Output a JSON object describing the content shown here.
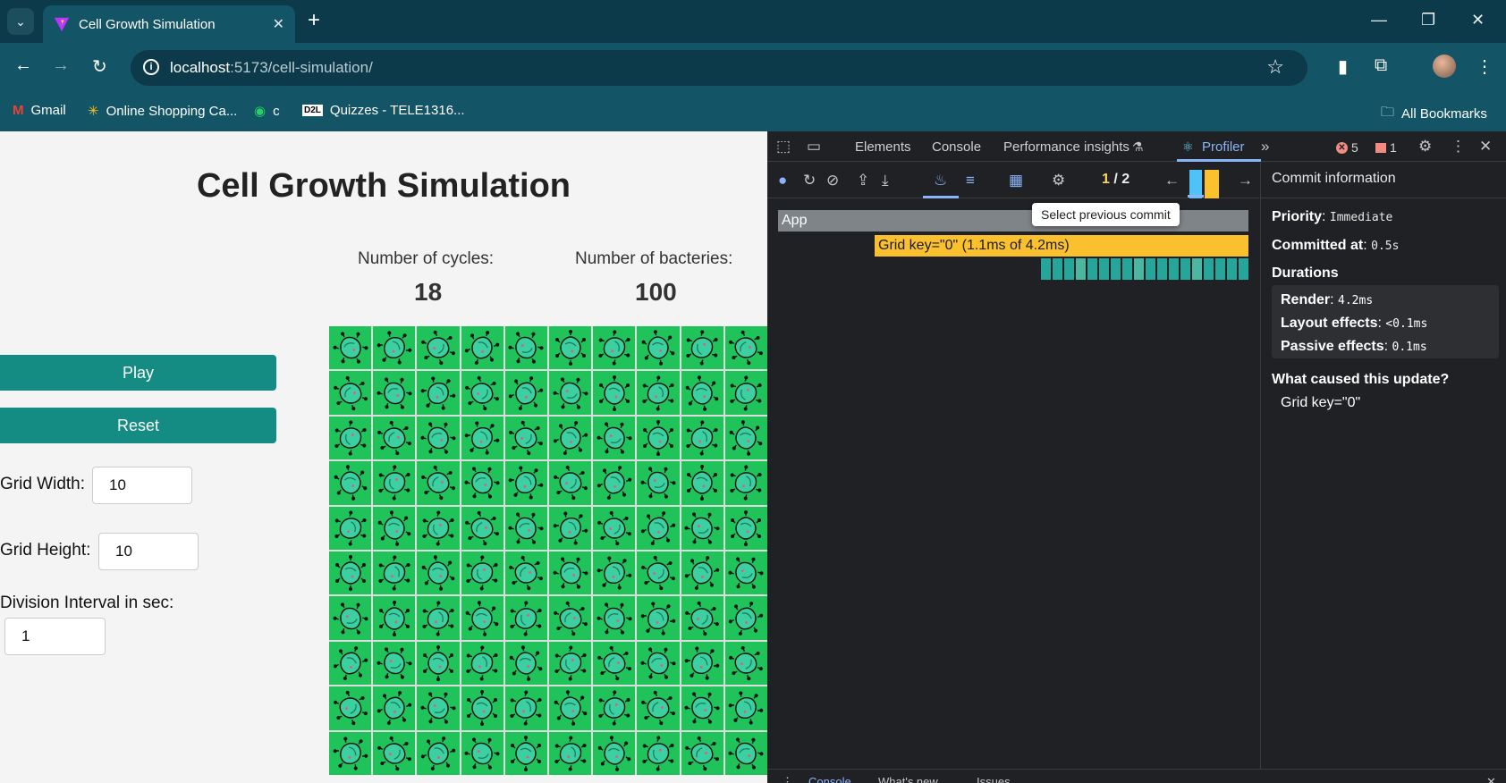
{
  "browser": {
    "tab_title": "Cell Growth Simulation",
    "url_host": "localhost",
    "url_path": ":5173/cell-simulation/",
    "bookmarks": [
      {
        "label": "Gmail",
        "icon": "gmail-icon"
      },
      {
        "label": "Online Shopping Ca...",
        "icon": "walmart-icon"
      },
      {
        "label": "c",
        "icon": "whatsapp-icon"
      },
      {
        "label": "Quizzes - TELE1316...",
        "icon": "d2l-icon"
      }
    ],
    "all_bookmarks": "All Bookmarks"
  },
  "app": {
    "title": "Cell Growth Simulation",
    "cycles_label": "Number of cycles:",
    "cycles_value": "18",
    "bacteries_label": "Number of bacteries:",
    "bacteries_value": "100",
    "play_label": "Play",
    "reset_label": "Reset",
    "grid_width_label": "Grid Width:",
    "grid_width_value": "10",
    "grid_height_label": "Grid Height:",
    "grid_height_value": "10",
    "interval_label": "Division Interval in sec:",
    "interval_value": "1",
    "grid_rows": 10,
    "grid_cols": 10,
    "cell_color": "#1fc35a"
  },
  "devtools": {
    "tabs": [
      "Elements",
      "Console",
      "Performance insights",
      "Profiler"
    ],
    "active_tab": "Profiler",
    "error_count": "5",
    "warning_count": "1",
    "commit_current": "1",
    "commit_sep": "/",
    "commit_total": "2",
    "tooltip": "Select previous commit",
    "flame_app": "App",
    "flame_grid": "Grid key=\"0\" (1.1ms of 4.2ms)",
    "commit_info_title": "Commit information",
    "priority_label": "Priority",
    "priority_value": "Immediate",
    "committed_label": "Committed at",
    "committed_value": "0.5s",
    "durations_label": "Durations",
    "render_label": "Render",
    "render_value": "4.2ms",
    "layout_label": "Layout effects",
    "layout_value": "<0.1ms",
    "passive_label": "Passive effects",
    "passive_value": "0.1ms",
    "cause_label": "What caused this update?",
    "cause_value": "Grid key=\"0\"",
    "drawer_tabs": [
      "Console",
      "What's new",
      "Issues"
    ]
  }
}
